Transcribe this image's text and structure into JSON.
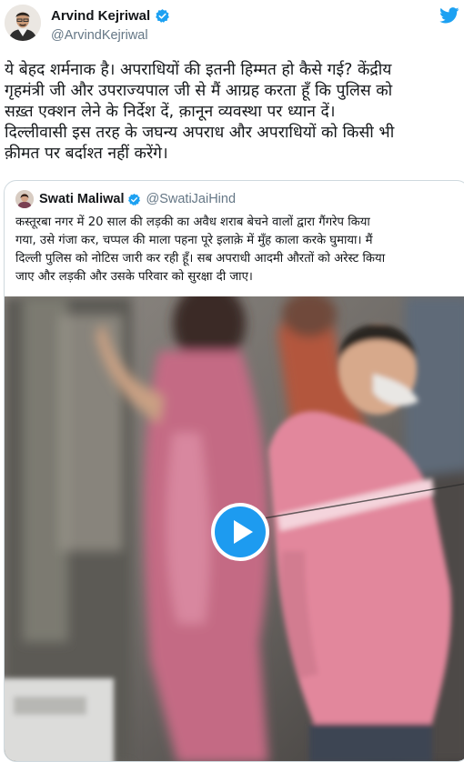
{
  "author": {
    "name": "Arvind Kejriwal",
    "handle": "@ArvindKejriwal",
    "verified_icon": "verified-badge-icon",
    "platform_icon": "twitter-bird-icon",
    "accent_color": "#1da1f2"
  },
  "tweet": {
    "lines": [
      "ये बेहद शर्मनाक है। अपराधियों की इतनी हिम्मत हो कैसे गई? केंद्रीय",
      "गृहमंत्री जी और उपराज्यपाल जी से मैं आग्रह करता हूँ कि पुलिस को",
      "सख़्त एक्शन लेने के निर्देश दें, क़ानून व्यवस्था पर ध्यान दें।",
      "दिल्लीवासी इस तरह के जघन्य अपराध और अपराधियों को किसी भी",
      "क़ीमत पर बर्दाश्त नहीं करेंगे।"
    ]
  },
  "quoted_tweet": {
    "name": "Swati Maliwal",
    "handle": "@SwatiJaiHind",
    "lines": [
      "कस्तूरबा नगर में 20 साल की लड़की का अवैध शराब बेचने वालों द्वारा गैंगरेप किया",
      "गया, उसे गंजा कर, चप्पल की माला पहना पूरे इलाक़े में मुँह काला करके घुमाया। मैं",
      "दिल्ली पुलिस को नोटिस जारी कर रही हूँ। सब अपराधी आदमी औरतों को अरेस्ट किया",
      "जाए और लड़की और उसके परिवार को सुरक्षा दी जाए।"
    ],
    "media": {
      "type": "video",
      "play_icon": "play-icon",
      "play_color": "#1d9bf0"
    }
  }
}
